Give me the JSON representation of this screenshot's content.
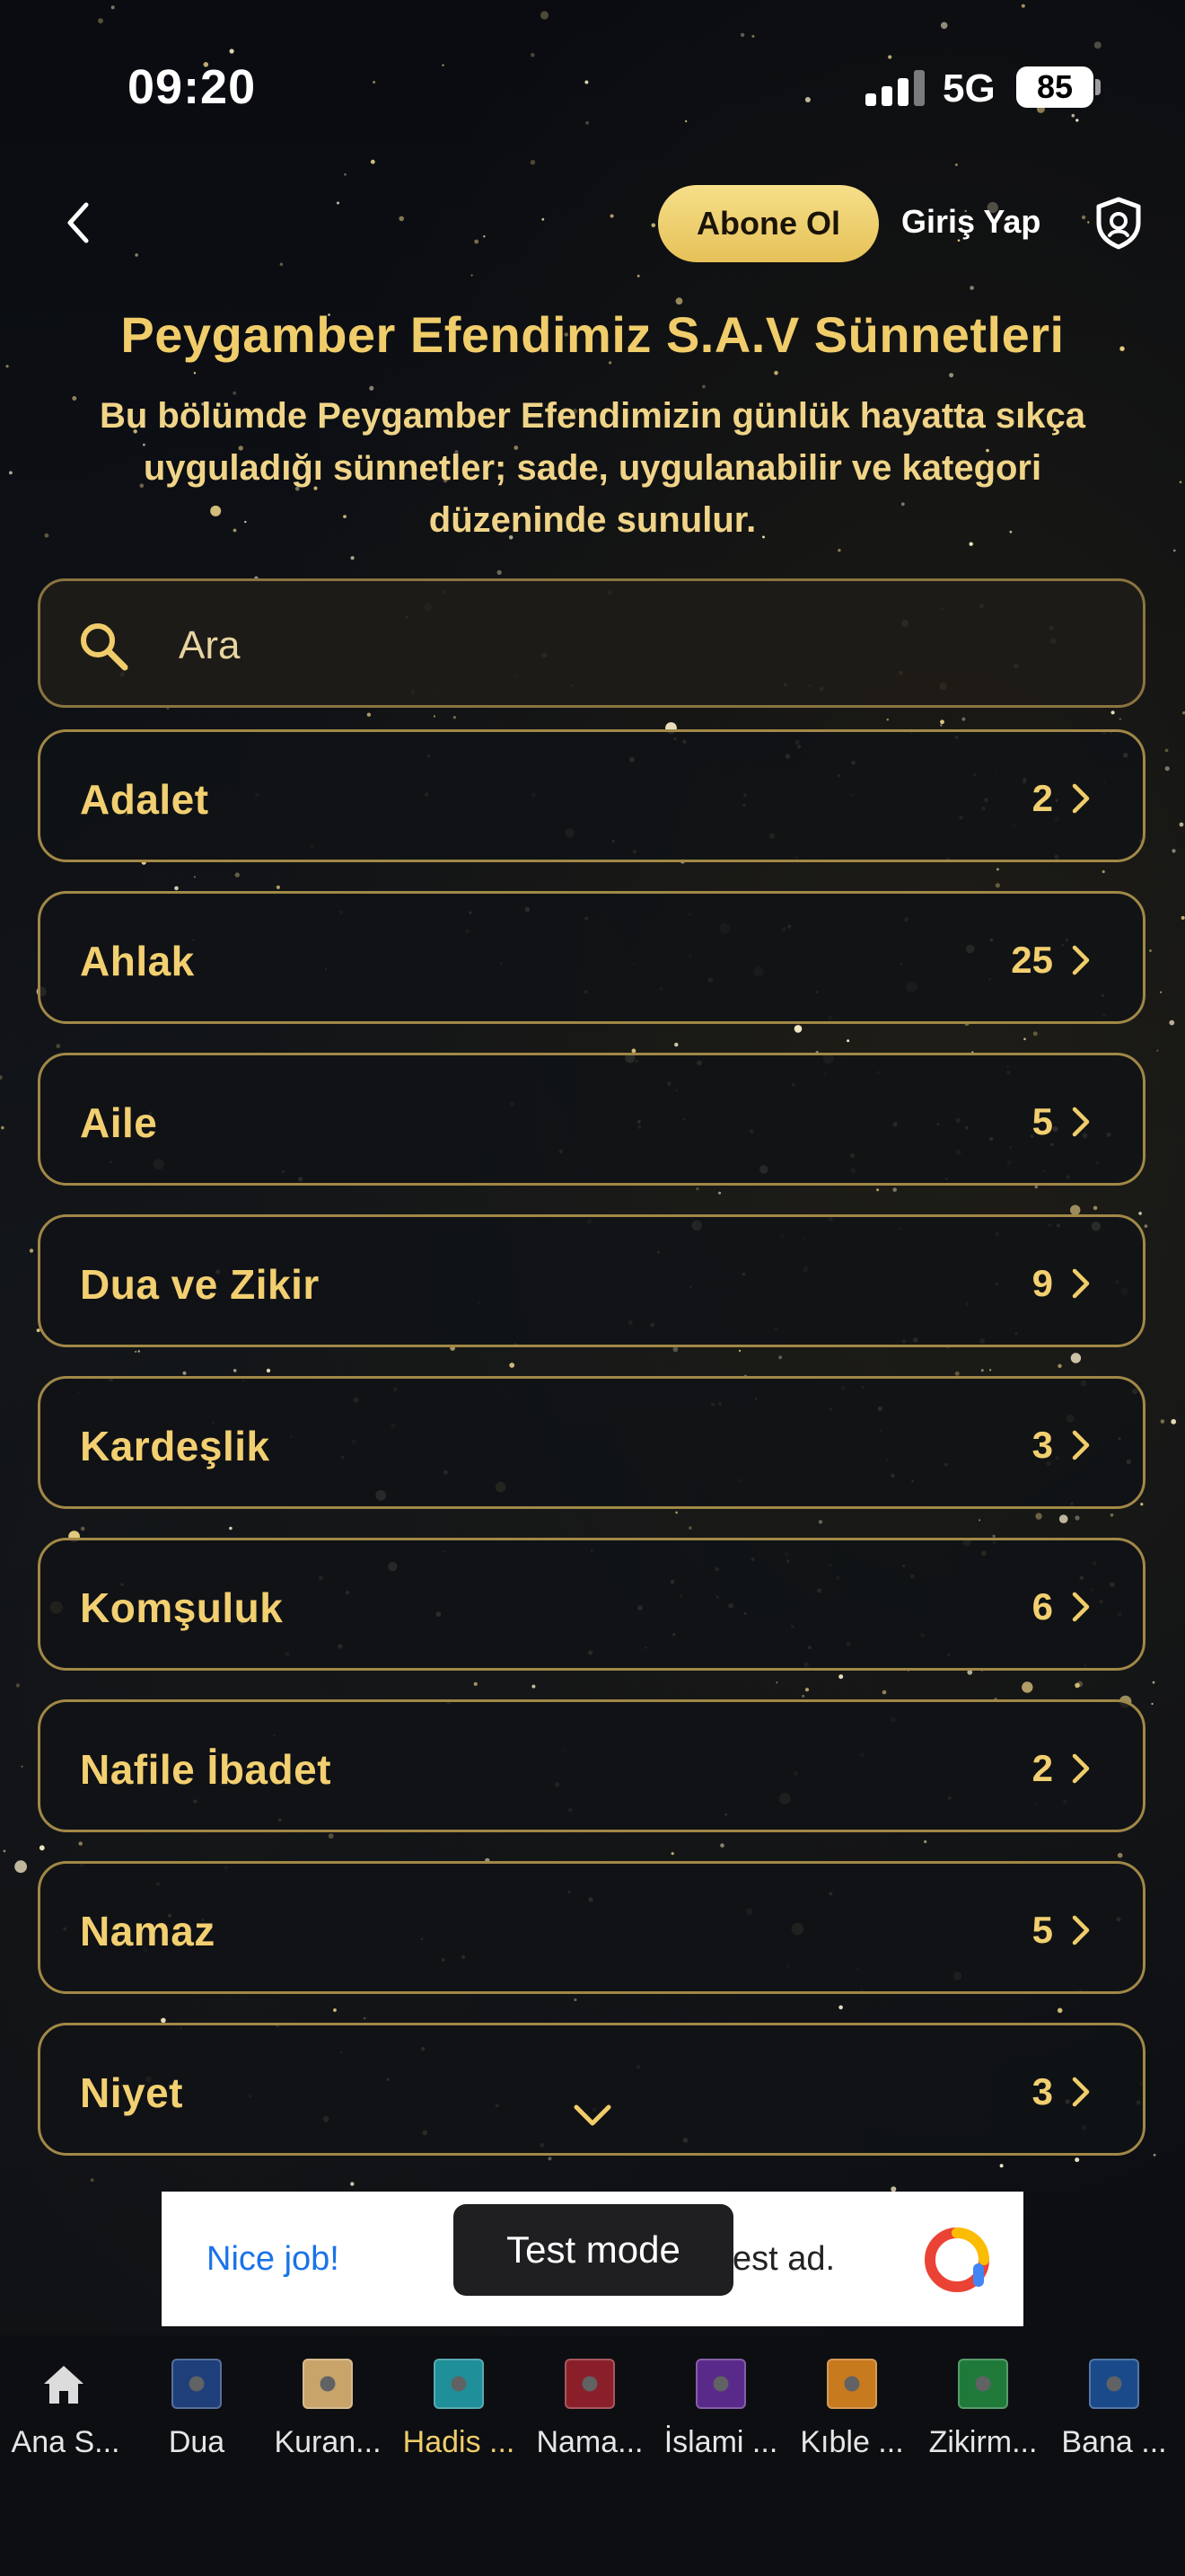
{
  "status_bar": {
    "time": "09:20",
    "network": "5G",
    "battery": "85"
  },
  "header": {
    "subscribe_label": "Abone Ol",
    "login_label": "Giriş Yap"
  },
  "page": {
    "title": "Peygamber Efendimiz S.A.V Sünnetleri",
    "subtitle": "Bu bölümde Peygamber Efendimizin günlük hayatta sıkça uyguladığı sünnetler; sade, uygulanabilir ve kategori düzeninde sunulur."
  },
  "search": {
    "placeholder": "Ara",
    "value": ""
  },
  "categories": [
    {
      "label": "Adalet",
      "count": "2"
    },
    {
      "label": "Ahlak",
      "count": "25"
    },
    {
      "label": "Aile",
      "count": "5"
    },
    {
      "label": "Dua ve Zikir",
      "count": "9"
    },
    {
      "label": "Kardeşlik",
      "count": "3"
    },
    {
      "label": "Komşuluk",
      "count": "6"
    },
    {
      "label": "Nafile İbadet",
      "count": "2"
    },
    {
      "label": "Namaz",
      "count": "5"
    },
    {
      "label": "Niyet",
      "count": "3"
    }
  ],
  "ad": {
    "left_text": "Nice job!",
    "right_text": "est ad.",
    "toast": "Test mode"
  },
  "tabs": [
    {
      "label": "Ana S...",
      "icon": "home-icon",
      "color": "#d9d9d9",
      "active": false
    },
    {
      "label": "Dua",
      "icon": "dua-icon",
      "color": "#1e3f7a",
      "active": false
    },
    {
      "label": "Kuran...",
      "icon": "quran-icon",
      "color": "#c9a46a",
      "active": false
    },
    {
      "label": "Hadis ...",
      "icon": "hadith-icon",
      "color": "#1f8f99",
      "active": true
    },
    {
      "label": "Nama...",
      "icon": "prayer-icon",
      "color": "#8a1f2a",
      "active": false
    },
    {
      "label": "İslami ...",
      "icon": "islamic-icon",
      "color": "#5a2a8a",
      "active": false
    },
    {
      "label": "Kıble ...",
      "icon": "qibla-icon",
      "color": "#c87a1e",
      "active": false
    },
    {
      "label": "Zikirm...",
      "icon": "dhikr-icon",
      "color": "#1f7a3a",
      "active": false
    },
    {
      "label": "Bana ...",
      "icon": "me-icon",
      "color": "#1a4a8a",
      "active": false
    }
  ],
  "colors": {
    "accent_gold": "#f0cd6a",
    "border_gold": "#a18847",
    "button_gold": "#f2d676"
  }
}
